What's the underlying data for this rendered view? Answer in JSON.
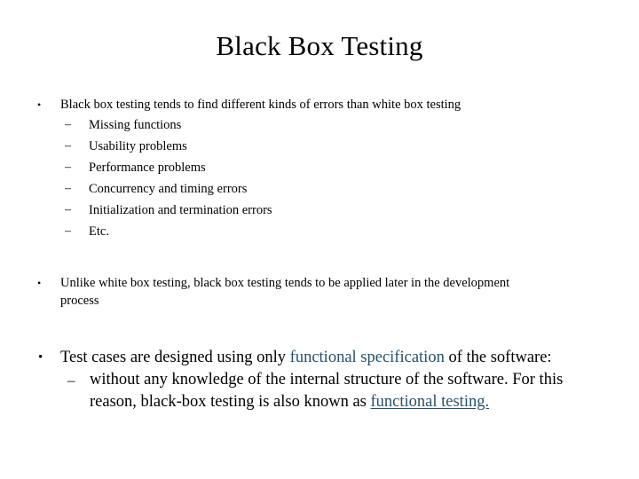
{
  "slide": {
    "title": "Black Box Testing",
    "background_color": "#ffffff",
    "text_color": "#000000",
    "accent_color": "#26506e",
    "bullet_glyph_level1": "•",
    "bullet_glyph_level2": "–"
  },
  "blocks": {
    "block1": {
      "bullet": "Black box testing tends to find different kinds of errors than white box testing",
      "subitems": [
        "Missing functions",
        "Usability problems",
        "Performance problems",
        "Concurrency and timing errors",
        "Initialization and termination errors",
        "Etc."
      ]
    },
    "block2": {
      "bullet": "Unlike white box testing, black box testing tends to be applied later in the development process"
    },
    "block3": {
      "bullet_part1": "Test cases are designed using only ",
      "bullet_accent": "functional specification",
      "bullet_part2": " of the software:",
      "subitem": {
        "part1": "without any knowledge of the internal structure of the software. For this reason, black-box testing is also known as  ",
        "accent_underlined": "functional testing."
      }
    }
  }
}
